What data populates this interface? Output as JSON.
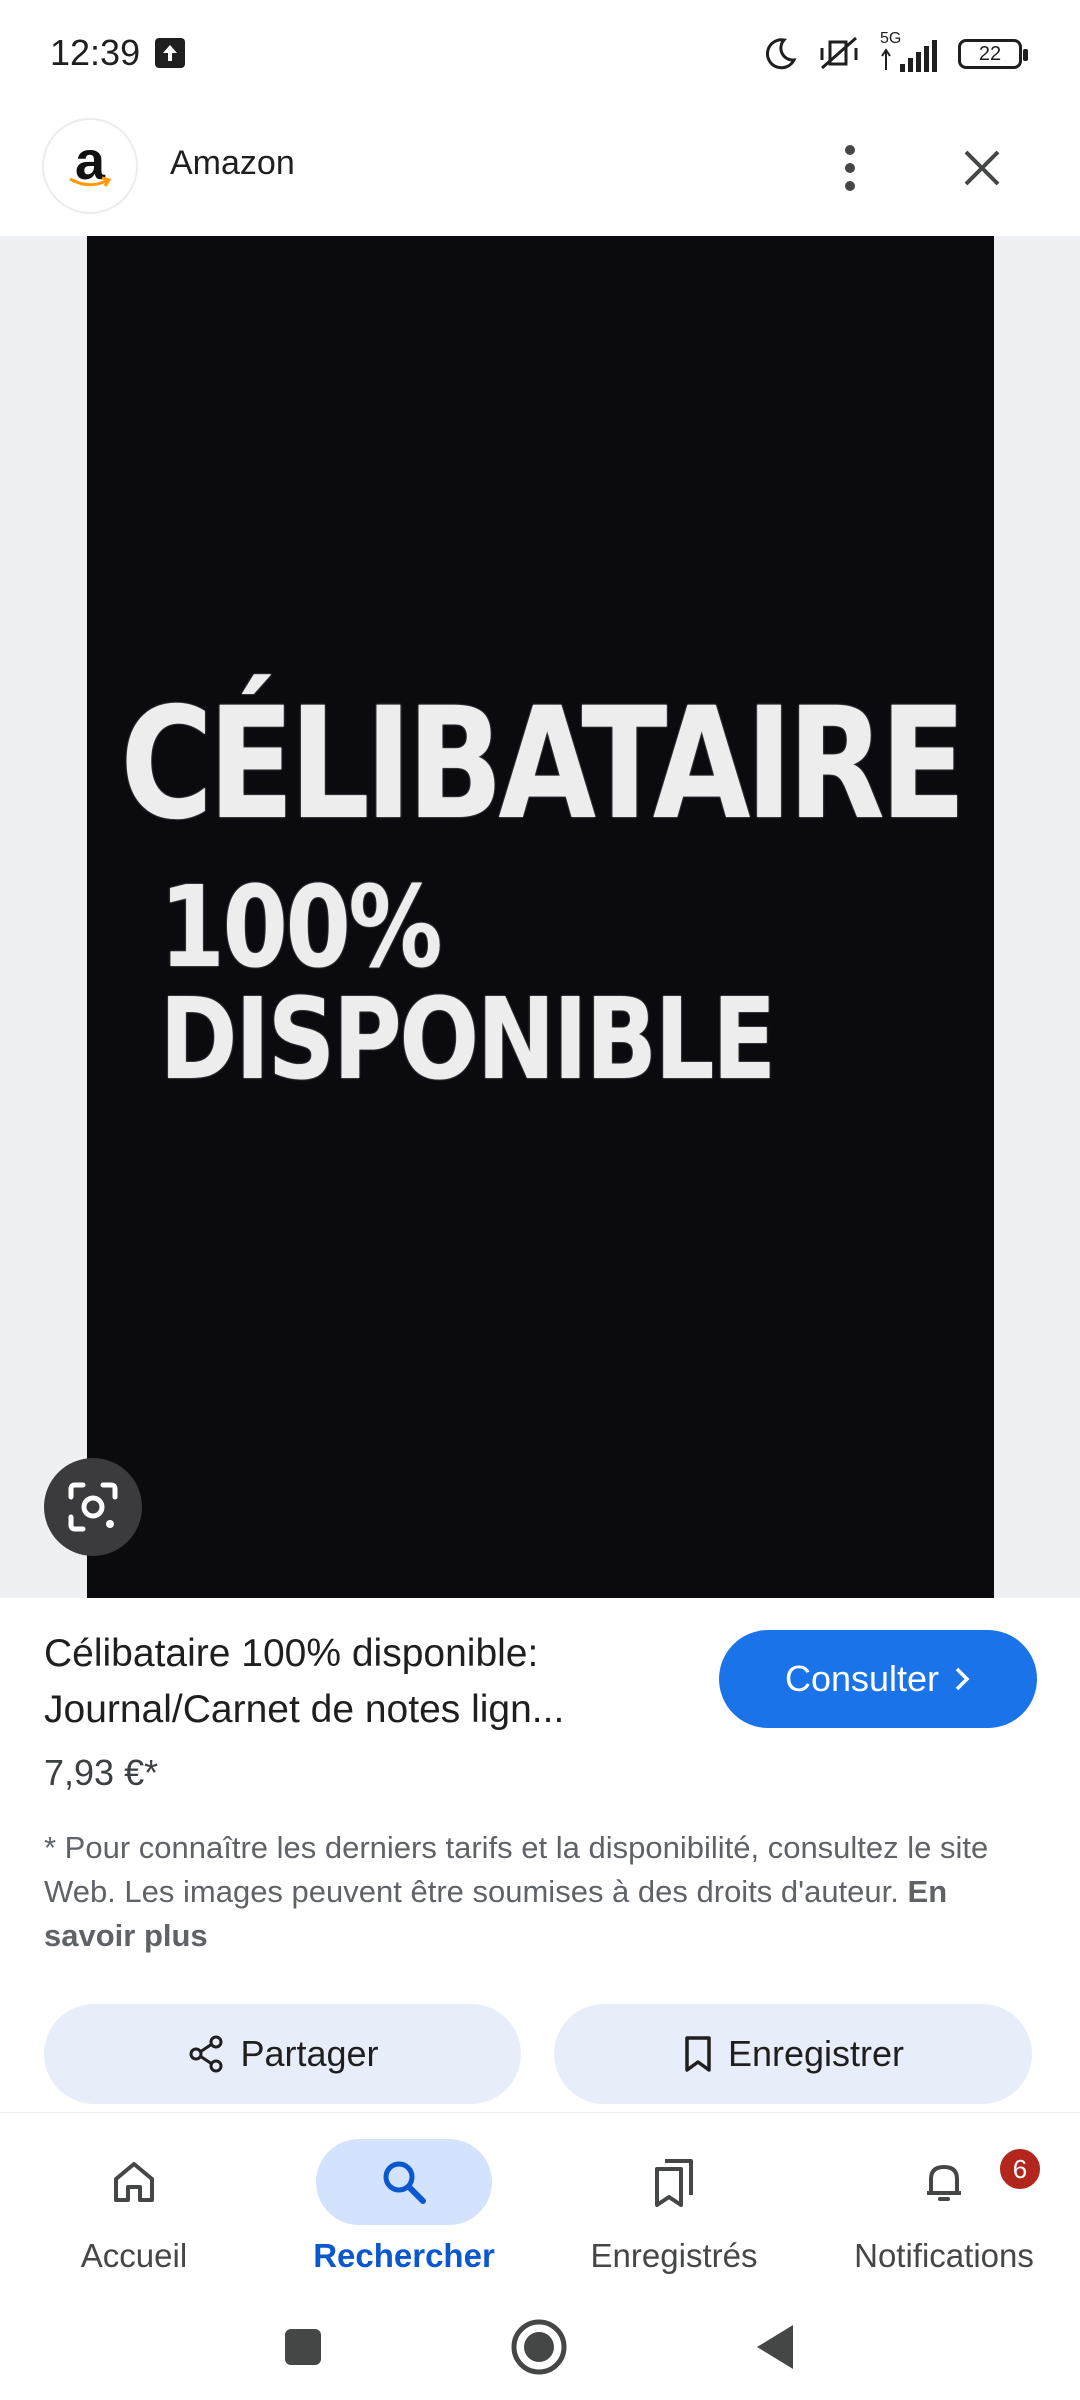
{
  "status_bar": {
    "time": "12:39",
    "network": "5G",
    "battery": "22"
  },
  "header": {
    "site_logo_letter": "a",
    "site_name": "Amazon"
  },
  "image": {
    "cover_line1": "CÉLIBATAIRE",
    "cover_line2": "100% DISPONIBLE"
  },
  "product": {
    "title": "Célibataire 100% disponible: Journal/Carnet de notes lign...",
    "price": "7,93 €*",
    "visit_label": "Consulter",
    "disclaimer": "* Pour connaître les derniers tarifs et la disponibilité, consultez le site Web. Les images peuvent être soumises à des droits d'auteur.",
    "learn_more": "En savoir plus"
  },
  "actions": {
    "share_label": "Partager",
    "save_label": "Enregistrer"
  },
  "bottom_nav": {
    "items": [
      {
        "label": "Accueil",
        "icon": "home-icon"
      },
      {
        "label": "Rechercher",
        "icon": "search-icon",
        "active": true
      },
      {
        "label": "Enregistrés",
        "icon": "bookmarks-icon"
      },
      {
        "label": "Notifications",
        "icon": "bell-icon",
        "badge": "6"
      }
    ]
  },
  "colors": {
    "accent": "#1a73e8",
    "active_nav": "#0b57d0",
    "badge": "#b3261e",
    "action_button_bg": "#e8eef9"
  }
}
